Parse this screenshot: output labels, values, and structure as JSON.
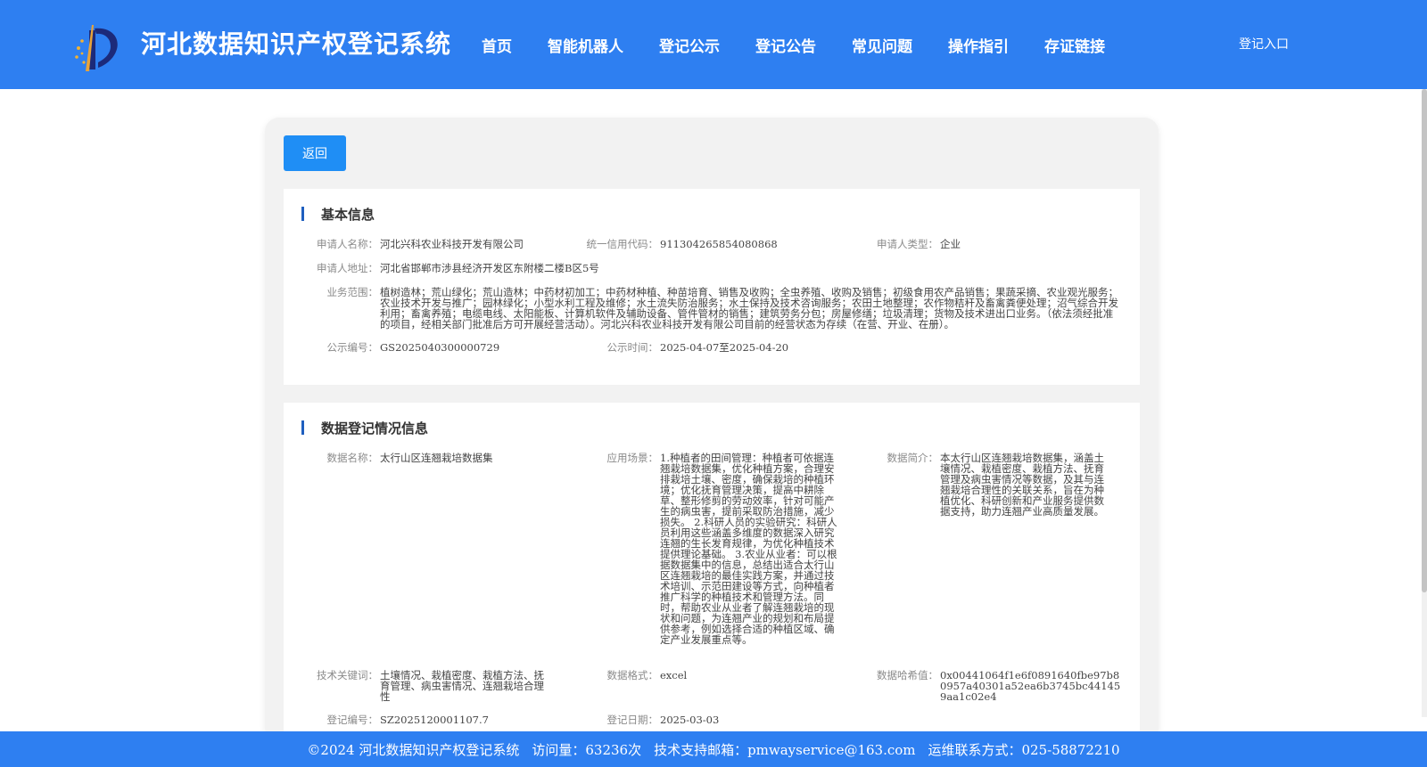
{
  "header": {
    "title": "河北数据知识产权登记系统",
    "login_label": "登记入口",
    "nav": [
      "首页",
      "智能机器人",
      "登记公示",
      "登记公告",
      "常见问题",
      "操作指引",
      "存证链接"
    ]
  },
  "card": {
    "back_label": "返回"
  },
  "basic": {
    "title": "基本信息",
    "applicant_name_label": "申请人名称：",
    "applicant_name": "河北兴科农业科技开发有限公司",
    "credit_code_label": "统一信用代码：",
    "credit_code": "911304265854080868",
    "applicant_type_label": "申请人类型：",
    "applicant_type": "企业",
    "address_label": "申请人地址：",
    "address": "河北省邯郸市涉县经济开发区东附楼二楼B区5号",
    "scope_label": "业务范围：",
    "scope": "植树造林；荒山绿化；荒山造林；中药材初加工；中药材种植、种苗培育、销售及收购；全虫养殖、收购及销售；初级食用农产品销售；果蔬采摘、农业观光服务；农业技术开发与推广；园林绿化；小型水利工程及维修；水土流失防治服务；水土保持及技术咨询服务；农田土地整理；农作物秸秆及畜禽粪便处理；沼气综合开发利用；畜禽养殖；电缆电线、太阳能板、计算机软件及辅助设备、管件管材的销售；建筑劳务分包；房屋修缮；垃圾清理；货物及技术进出口业务。（依法须经批准的项目，经相关部门批准后方可开展经营活动）。河北兴科农业科技开发有限公司目前的经营状态为存续（在营、开业、在册）。",
    "notice_no_label": "公示编号：",
    "notice_no": "GS2025040300000729",
    "notice_time_label": "公示时间：",
    "notice_time": "2025-04-07至2025-04-20"
  },
  "data_reg": {
    "title": "数据登记情况信息",
    "name_label": "数据名称：",
    "name": "太行山区连翘栽培数据集",
    "scenario_label": "应用场景：",
    "scenario": "1.种植者的田间管理：种植者可依据连翘栽培数据集，优化种植方案，合理安排栽培土壤、密度，确保栽培的种植环境；优化抚育管理决策，提高中耕除草、整形修剪的劳动效率，针对可能产生的病虫害，提前采取防治措施，减少损失。 2.科研人员的实验研究：科研人员利用这些涵盖多维度的数据深入研究连翘的生长发育规律，为优化种植技术提供理论基础。 3.农业从业者：可以根据数据集中的信息，总结出适合太行山区连翘栽培的最佳实践方案，并通过技术培训、示范田建设等方式，向种植者推广科学的种植技术和管理方法。同时，帮助农业从业者了解连翘栽培的现状和问题，为连翘产业的规划和布局提供参考，例如选择合适的种植区域、确定产业发展重点等。",
    "intro_label": "数据简介：",
    "intro": "本太行山区连翘栽培数据集，涵盖土壤情况、栽植密度、栽植方法、抚育管理及病虫害情况等数据，及其与连翘栽培合理性的关联关系，旨在为种植优化、科研创新和产业服务提供数据支持，助力连翘产业高质量发展。",
    "keywords_label": "技术关键词：",
    "keywords": "土壤情况、栽植密度、栽植方法、抚育管理、病虫害情况、连翘栽培合理性",
    "format_label": "数据格式：",
    "format": "excel",
    "hash_label": "数据哈希值：",
    "hash": "0x00441064f1e6f0891640fbe97b80957a40301a52ea6b3745bc441459aa1c02e4",
    "reg_no_label": "登记编号：",
    "reg_no": "SZ2025120001107.7",
    "reg_date_label": "登记日期：",
    "reg_date": "2025-03-03"
  },
  "footer": {
    "copyright": "©2024 河北数据知识产权登记系统",
    "visits": "访问量：63236次",
    "email": "技术支持邮箱：pmwayservice@163.com",
    "phone": "运维联系方式：025-58872210"
  }
}
